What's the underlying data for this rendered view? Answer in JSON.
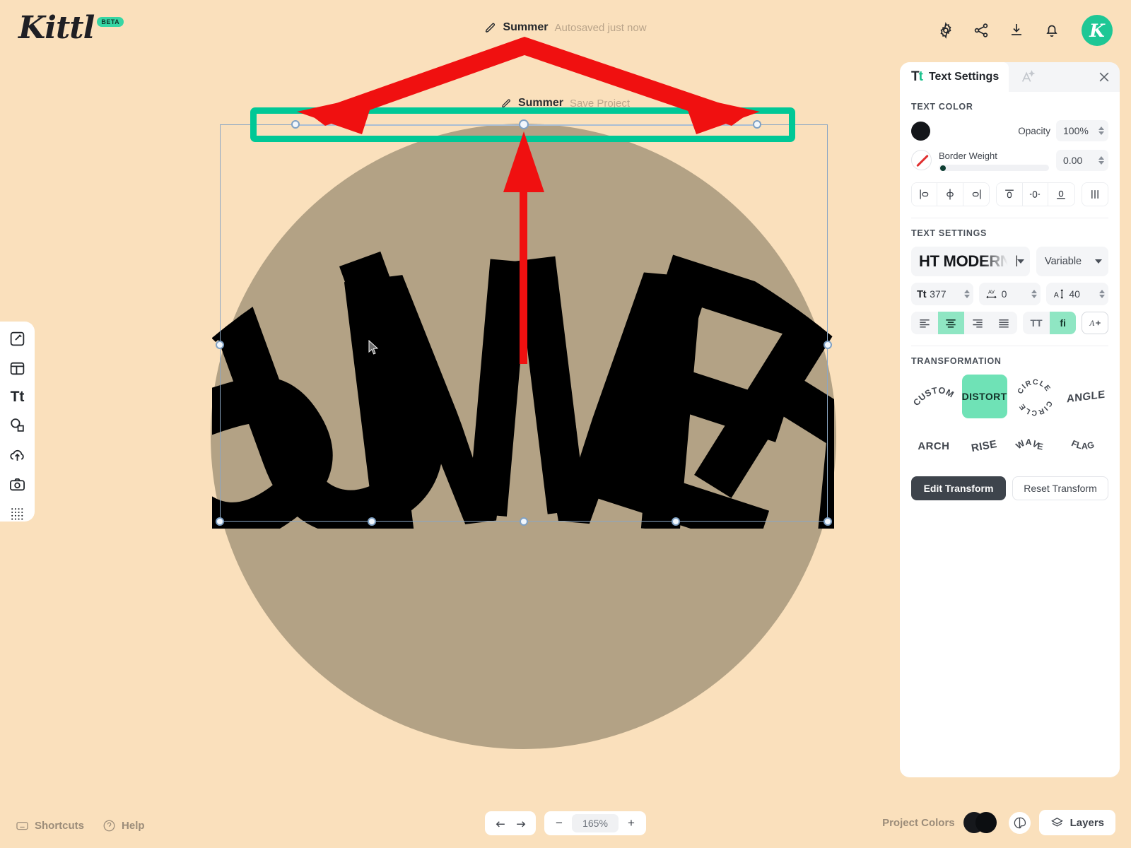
{
  "app": {
    "brand": "Kittl",
    "brand_badge": "BETA",
    "accent_green": "#17c08a",
    "highlight_green": "#00c896",
    "annotation_red": "#f01010",
    "canvas_bg": "#fae0bc",
    "artwork_circle_color": "#b3a285",
    "artwork_text_color": "#000000"
  },
  "header": {
    "doc_icon": "pen-icon",
    "doc_name": "Summer",
    "save_status": "Autosaved just now",
    "icons": [
      {
        "name": "settings-icon",
        "label": "Settings"
      },
      {
        "name": "share-icon",
        "label": "Share"
      },
      {
        "name": "download-icon",
        "label": "Download"
      },
      {
        "name": "notifications-icon",
        "label": "Notifications"
      }
    ],
    "avatar_initial": "K"
  },
  "ghost_menu": {
    "name": "Summer",
    "action": "Save Project"
  },
  "left_toolbar": {
    "items": [
      {
        "name": "templates-icon",
        "label": "Templates"
      },
      {
        "name": "layouts-icon",
        "label": "Layouts"
      },
      {
        "name": "text-icon",
        "label": "Text",
        "glyph": "Tt"
      },
      {
        "name": "elements-icon",
        "label": "Elements"
      },
      {
        "name": "uploads-icon",
        "label": "Uploads"
      },
      {
        "name": "photos-icon",
        "label": "Photos"
      },
      {
        "name": "patterns-icon",
        "label": "Patterns"
      }
    ]
  },
  "canvas": {
    "artwork_text": "SUMMER",
    "selection_visible": true,
    "distort_bar_handles": 3,
    "bottom_handles": 5
  },
  "panel": {
    "tabs": [
      {
        "name": "text-settings-tab",
        "label": "Text Settings",
        "icon": "tt-icon",
        "active": true
      },
      {
        "name": "effects-tab",
        "label": "",
        "icon": "magic-text-icon",
        "active": false
      }
    ],
    "close_label": "Close",
    "text_color": {
      "section_label": "TEXT COLOR",
      "fill_color": "#14161a",
      "opacity_label": "Opacity",
      "opacity_value": "100%",
      "border_weight_label": "Border Weight",
      "border_weight_value": "0.00",
      "border_color": "none"
    },
    "align_icons": [
      {
        "name": "align-left-icon"
      },
      {
        "name": "align-center-horizontal-icon"
      },
      {
        "name": "align-right-icon"
      },
      {
        "name": "align-top-icon"
      },
      {
        "name": "align-middle-vertical-icon"
      },
      {
        "name": "align-bottom-icon"
      },
      {
        "name": "distribute-icon"
      }
    ],
    "text_settings": {
      "section_label": "TEXT SETTINGS",
      "font_family": "HT MODERN HAN",
      "font_style": "Variable",
      "font_size": "377",
      "letter_spacing": "0",
      "line_height": "40",
      "alignments": [
        {
          "name": "text-align-left-icon",
          "active": false
        },
        {
          "name": "text-align-center-icon",
          "active": true
        },
        {
          "name": "text-align-right-icon",
          "active": false
        },
        {
          "name": "text-align-justify-icon",
          "active": false
        }
      ],
      "uppercase_label": "TT",
      "uppercase_active": false,
      "ligature_label": "fi",
      "ligature_active": true,
      "add-font-label": "A+"
    },
    "transformation": {
      "section_label": "TRANSFORMATION",
      "options": [
        {
          "name": "transform-custom",
          "label": "CUSTOM",
          "style": "arc",
          "active": false
        },
        {
          "name": "transform-distort",
          "label": "DISTORT",
          "style": "flat",
          "active": true
        },
        {
          "name": "transform-circle",
          "label": "CIRCLE",
          "style": "circle",
          "active": false
        },
        {
          "name": "transform-angle",
          "label": "ANGLE",
          "style": "angle",
          "active": false
        },
        {
          "name": "transform-arch",
          "label": "ARCH",
          "style": "arch",
          "active": false
        },
        {
          "name": "transform-rise",
          "label": "RISE",
          "style": "rise",
          "active": false
        },
        {
          "name": "transform-wave",
          "label": "WAVE",
          "style": "wave",
          "active": false
        },
        {
          "name": "transform-flag",
          "label": "FLAG",
          "style": "flag",
          "active": false
        }
      ],
      "edit_label": "Edit Transform",
      "reset_label": "Reset Transform"
    }
  },
  "bottom_bar": {
    "shortcuts_label": "Shortcuts",
    "help_label": "Help",
    "undo_icon": "undo-icon",
    "redo_icon": "redo-icon",
    "zoom_out": "−",
    "zoom_value": "165%",
    "zoom_in": "+",
    "project_colors_label": "Project Colors",
    "project_colors": [
      "#16181c",
      "#0c0e11"
    ],
    "palette_icon": "palette-icon",
    "layers_label": "Layers"
  }
}
